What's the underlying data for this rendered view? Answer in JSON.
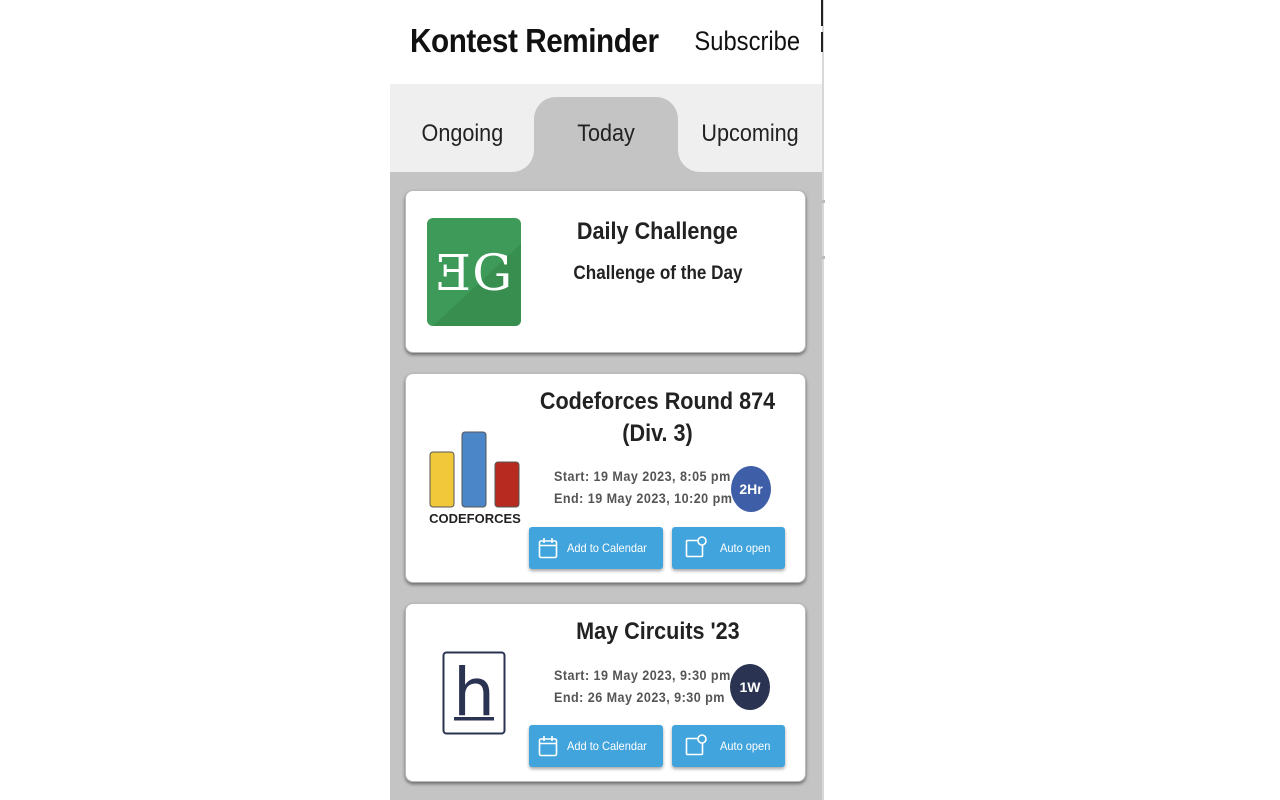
{
  "header": {
    "title": "Kontest Reminder",
    "subscribe_label": "Subscribe"
  },
  "tabs": [
    {
      "label": "Ongoing",
      "active": false
    },
    {
      "label": "Today",
      "active": true
    },
    {
      "label": "Upcoming",
      "active": false
    }
  ],
  "contests": [
    {
      "title": "Daily Challenge",
      "subtitle": "Challenge of the Day",
      "logo": "geeksforgeeks-logo",
      "logo_text": "ƎG"
    },
    {
      "title": "Codeforces Round 874 (Div. 3)",
      "start": "Start: 19 May 2023, 8:05 pm",
      "end": "End: 19 May 2023, 10:20 pm",
      "duration": "2Hr",
      "duration_color": "#3f5ea8",
      "logo": "codeforces-logo",
      "logo_text": "CODEFORCES",
      "add_calendar_label": "Add to Calendar",
      "auto_open_label": "Auto open"
    },
    {
      "title": "May Circuits '23",
      "start": "Start: 19 May 2023, 9:30 pm",
      "end": "End: 26 May 2023, 9:30 pm",
      "duration": "1W",
      "duration_color": "#2b3352",
      "logo": "hackerearth-logo",
      "logo_text": "h",
      "add_calendar_label": "Add to Calendar",
      "auto_open_label": "Auto open"
    }
  ],
  "colors": {
    "button": "#42a4dc",
    "panel_background": "#c4c4c4",
    "tab_background": "#efefef",
    "gfg_green": "#3e9a58"
  }
}
